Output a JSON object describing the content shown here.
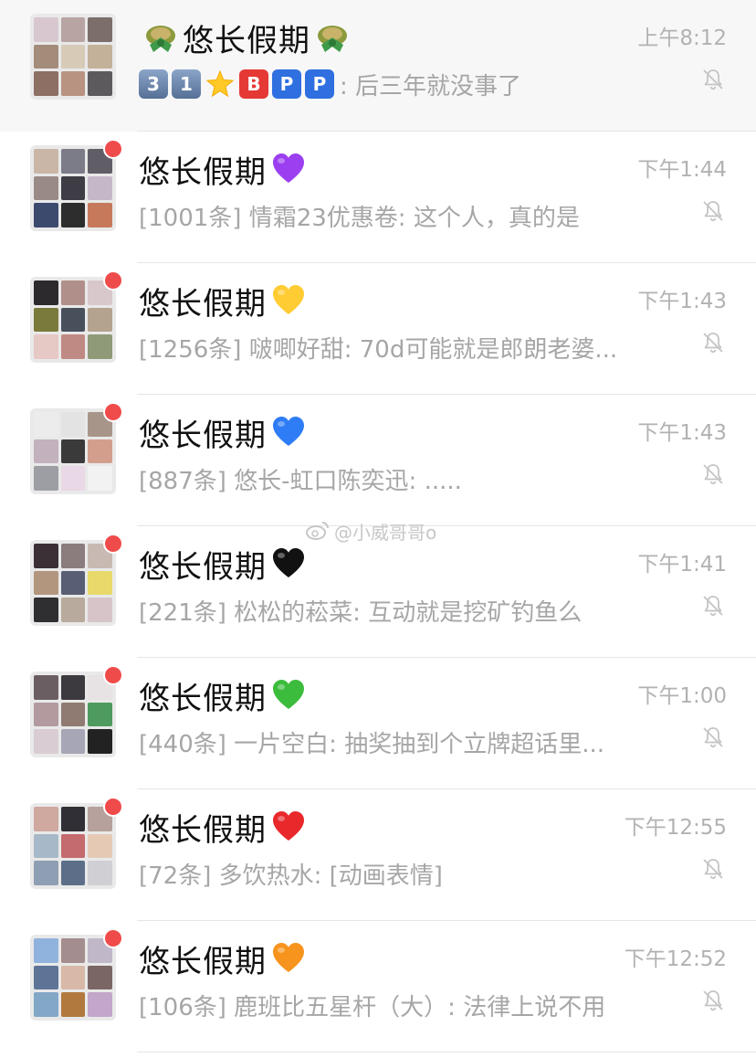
{
  "colors": {
    "pinned_bg": "#f7f7f7",
    "title": "#111111",
    "secondary": "#a6a6a6",
    "unread_dot": "#f04b4b"
  },
  "chats": [
    {
      "title": "悠长假期",
      "time": "上午8:12",
      "pinned": true,
      "unread": false,
      "title_decoration": "avocado-pair",
      "preview_badges": [
        "3",
        "1",
        "★",
        "B",
        "P",
        "P"
      ],
      "preview": ": 后三年就没事了",
      "muted": true,
      "avatar_colors": [
        "#d9c7d0",
        "#b9a4a4",
        "#7c6e6a",
        "#a48c7a",
        "#d7cbb8",
        "#c3b19a",
        "#8d6f63",
        "#b89382",
        "#5c5a5c"
      ]
    },
    {
      "title": "悠长假期",
      "time": "下午1:44",
      "pinned": false,
      "unread": true,
      "title_decoration": "purple-heart",
      "preview": "[1001条] 情霜23优惠卷: 这个人，真的是",
      "muted": true,
      "avatar_colors": [
        "#c9b6a6",
        "#7b7c88",
        "#605d66",
        "#9a8a86",
        "#3e3d45",
        "#c6b7c8",
        "#3c4a6e",
        "#2d2d2d",
        "#c77a5b"
      ]
    },
    {
      "title": "悠长假期",
      "time": "下午1:43",
      "pinned": false,
      "unread": true,
      "title_decoration": "yellow-heart",
      "preview": "[1256条] 啵唧好甜: 70d可能就是郎朗老婆...",
      "muted": true,
      "avatar_colors": [
        "#2d2a2e",
        "#b08f8a",
        "#d8c7cb",
        "#7a7a3b",
        "#48505c",
        "#b4a38f",
        "#e6c8c4",
        "#c08a84",
        "#8f9a78"
      ]
    },
    {
      "title": "悠长假期",
      "time": "下午1:43",
      "pinned": false,
      "unread": true,
      "title_decoration": "blue-heart",
      "preview": "[887条] 悠长-虹口陈奕迅: .....",
      "muted": true,
      "avatar_colors": [
        "#ececec",
        "#e3e3e3",
        "#a8958a",
        "#c3b1bd",
        "#3a3a3a",
        "#d39f8c",
        "#9c9ea3",
        "#e9d8e6",
        "#f2f2f2"
      ]
    },
    {
      "title": "悠长假期",
      "time": "下午1:41",
      "pinned": false,
      "unread": true,
      "title_decoration": "black-heart",
      "preview": "[221条] 松松的菘菜: 互动就是挖矿钓鱼么",
      "muted": true,
      "avatar_colors": [
        "#3b3035",
        "#8b7c7e",
        "#c8b9b2",
        "#b3967e",
        "#5a5e75",
        "#e8d96a",
        "#2f2f32",
        "#b8aa9d",
        "#d7c4c9"
      ]
    },
    {
      "title": "悠长假期",
      "time": "下午1:00",
      "pinned": false,
      "unread": true,
      "title_decoration": "green-heart",
      "preview": "[440条] 一片空白: 抽奖抽到个立牌超话里...",
      "muted": true,
      "avatar_colors": [
        "#6b5e62",
        "#3d3a3f",
        "#e7e2e4",
        "#b39a9f",
        "#8f7b71",
        "#4f9a5e",
        "#d9ccd2",
        "#a6a6b6",
        "#222222"
      ]
    },
    {
      "title": "悠长假期",
      "time": "下午12:55",
      "pinned": false,
      "unread": true,
      "title_decoration": "red-heart",
      "preview": "[72条] 多饮热水: [动画表情]",
      "muted": true,
      "avatar_colors": [
        "#cfa8a0",
        "#2f2f35",
        "#b7a19c",
        "#a7b9c8",
        "#c46b6e",
        "#e6c9b4",
        "#8f9fb3",
        "#5d6f88",
        "#d0cfd4"
      ]
    },
    {
      "title": "悠长假期",
      "time": "下午12:52",
      "pinned": false,
      "unread": true,
      "title_decoration": "orange-heart",
      "preview": "[106条] 鹿班比五星杆（大）: 法律上说不用",
      "muted": true,
      "avatar_colors": [
        "#8fb3dc",
        "#a48d8f",
        "#c0b7c9",
        "#5d7496",
        "#d8b8a6",
        "#7b6666",
        "#83a7c7",
        "#b1793e",
        "#c3a6c9"
      ]
    }
  ],
  "watermark": {
    "text": "@小威哥哥o",
    "icon": "weibo-icon"
  }
}
